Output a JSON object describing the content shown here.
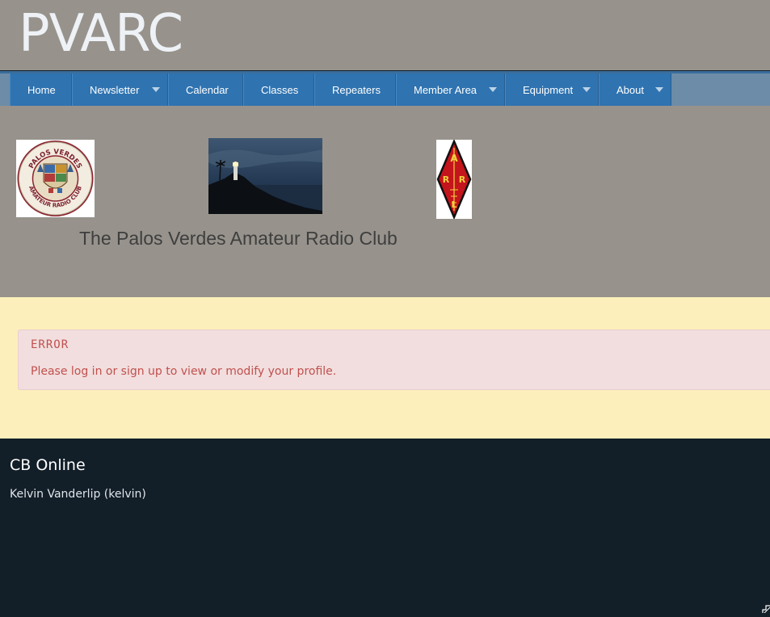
{
  "site": {
    "title": "PVARC"
  },
  "nav": {
    "items": [
      {
        "label": "Home",
        "dropdown": false
      },
      {
        "label": "Newsletter",
        "dropdown": true
      },
      {
        "label": "Calendar",
        "dropdown": false
      },
      {
        "label": "Classes",
        "dropdown": false
      },
      {
        "label": "Repeaters",
        "dropdown": false
      },
      {
        "label": "Member Area",
        "dropdown": true
      },
      {
        "label": "Equipment",
        "dropdown": true
      },
      {
        "label": "About",
        "dropdown": true
      }
    ]
  },
  "banner": {
    "club_name": "The Palos Verdes Amateur Radio Club",
    "logo_pv_text": "PALOS VERDES AMATEUR RADIO CLUB",
    "arrl_letters": [
      "A",
      "R",
      "R",
      "L"
    ]
  },
  "alert": {
    "title": "ERROR",
    "message": "Please log in or sign up to view or modify your profile."
  },
  "footer": {
    "heading": "CB Online",
    "online_user": "Kelvin Vanderlip (kelvin)"
  },
  "colors": {
    "header_bg": "#97938c",
    "nav_bg": "#2f73b0",
    "content_bg": "#fdefbb",
    "alert_bg": "#f2dede",
    "alert_text": "#c0514e",
    "footer_bg": "#121e28"
  },
  "icons": {
    "nav_caret": "caret-down-icon",
    "resize": "resize-handle-icon"
  }
}
